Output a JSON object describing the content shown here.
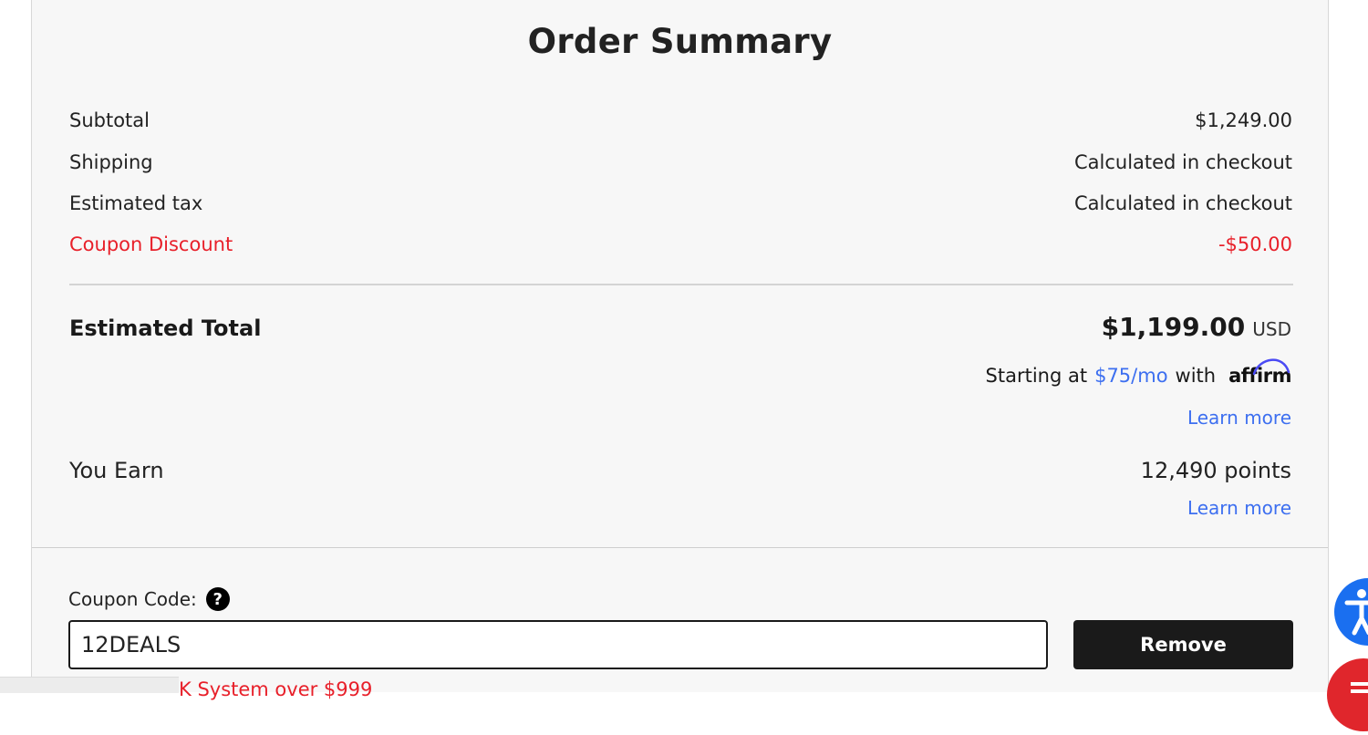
{
  "summary": {
    "title": "Order Summary",
    "subtotal_label": "Subtotal",
    "subtotal_value": "$1,249.00",
    "shipping_label": "Shipping",
    "shipping_value": "Calculated in checkout",
    "tax_label": "Estimated tax",
    "tax_value": "Calculated in checkout",
    "coupon_discount_label": "Coupon Discount",
    "coupon_discount_value": "-$50.00",
    "total_label": "Estimated Total",
    "total_value": "$1,199.00",
    "total_currency": "USD"
  },
  "affirm": {
    "prefix": "Starting at",
    "monthly": "$75/mo",
    "with": "with",
    "logo_text": "affirm",
    "learn_more": "Learn more"
  },
  "rewards": {
    "label": "You Earn",
    "value": "12,490 points",
    "learn_more": "Learn more"
  },
  "coupon": {
    "label": "Coupon Code:",
    "help_glyph": "?",
    "value": "12DEALS",
    "remove_label": "Remove",
    "notice_partial": "K System over $999"
  },
  "colors": {
    "accent_red": "#e8202a",
    "link_blue": "#3d6ff0",
    "button_dark": "#1a1a1a",
    "panel_bg": "#f7f7f7"
  },
  "icons": {
    "help": "question-circle-icon",
    "accessibility": "accessibility-icon",
    "chat": "chat-icon"
  }
}
